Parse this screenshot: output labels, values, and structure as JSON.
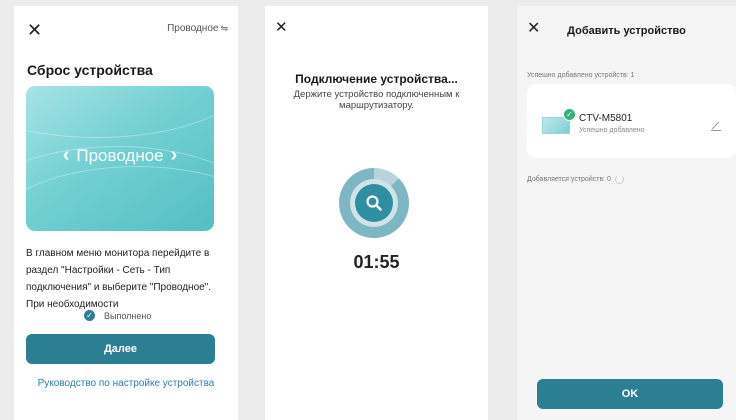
{
  "screen1": {
    "mode_label": "Проводное",
    "mode_switch_icon": "⇋",
    "title": "Сброс устройства",
    "card_label": "Проводное",
    "instructions": "В главном меню монитора перейдите в раздел \"Настройки - Сеть - Тип подключения\" и выберите \"Проводное\". При необходимости",
    "done_label": "Выполнено",
    "next_button": "Далее",
    "guide_link": "Руководство по настройке устройства"
  },
  "screen2": {
    "title": "Подключение устройства...",
    "subtitle": "Держите устройство подключенным к маршрутизатору.",
    "timer": "01:55"
  },
  "screen3": {
    "title": "Добавить устройство",
    "added_count": "Успешно добавлено устройств: 1",
    "device_name": "CTV-M5801",
    "device_status": "Успешно добавлено",
    "adding_count": "Добавляется устройств: 0",
    "ok_button": "OK"
  },
  "icons": {
    "close": "close-icon",
    "search": "search-icon",
    "edit": "edit-pencil-icon",
    "check": "check-icon"
  },
  "colors": {
    "primary_button": "#2c7f93",
    "link": "#2a7ea8",
    "success": "#2eb572"
  }
}
